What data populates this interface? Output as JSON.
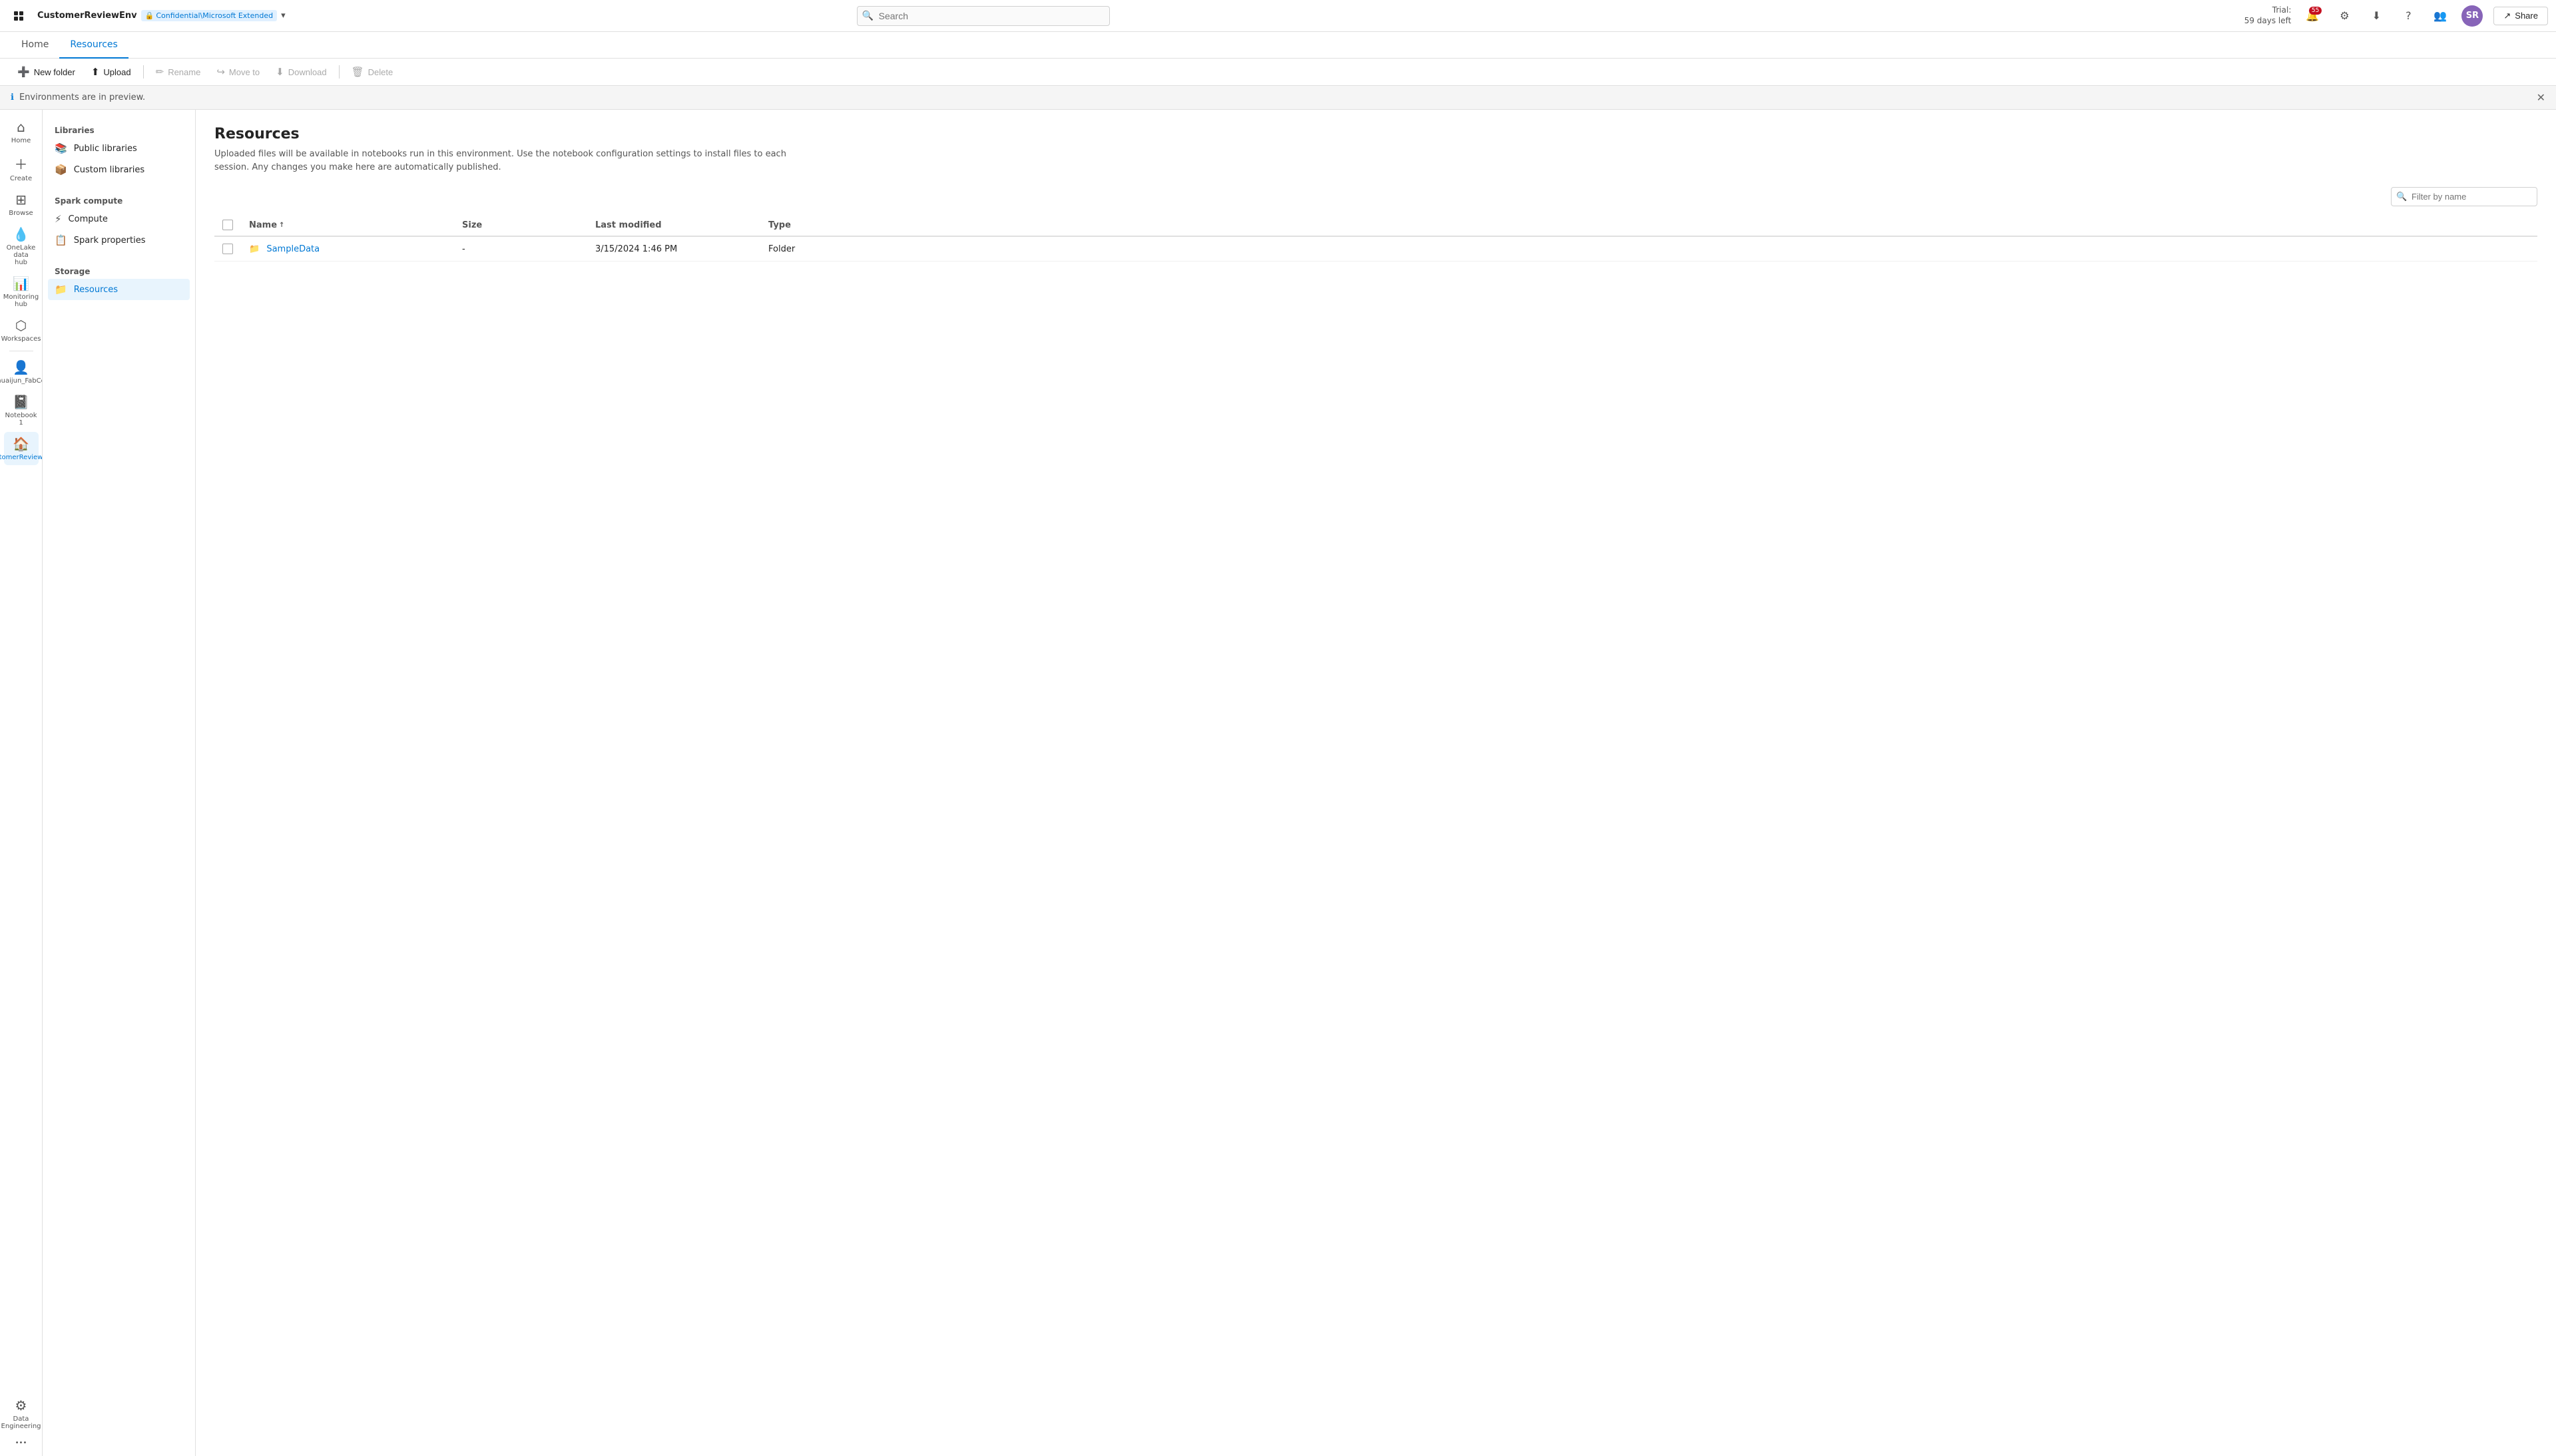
{
  "topbar": {
    "apps_label": "Apps",
    "env_name": "CustomerReviewEnv",
    "confidential_label": "Confidential\\Microsoft Extended",
    "dropdown_icon": "▾",
    "search_placeholder": "Search",
    "trial_line1": "Trial:",
    "trial_line2": "59 days left",
    "notif_count": "55",
    "share_label": "Share",
    "avatar_initials": "SR"
  },
  "nav": {
    "tabs": [
      {
        "id": "home",
        "label": "Home"
      },
      {
        "id": "resources",
        "label": "Resources"
      }
    ],
    "active_tab": "resources"
  },
  "toolbar": {
    "new_folder_label": "New folder",
    "upload_label": "Upload",
    "rename_label": "Rename",
    "move_to_label": "Move to",
    "download_label": "Download",
    "delete_label": "Delete"
  },
  "banner": {
    "message": "Environments are in preview."
  },
  "icon_nav": {
    "items": [
      {
        "id": "home",
        "icon": "⌂",
        "label": "Home"
      },
      {
        "id": "create",
        "icon": "+",
        "label": "Create"
      },
      {
        "id": "browse",
        "icon": "⊞",
        "label": "Browse"
      },
      {
        "id": "onelake",
        "icon": "💧",
        "label": "OneLake data hub"
      },
      {
        "id": "monitoring",
        "icon": "📊",
        "label": "Monitoring hub"
      },
      {
        "id": "workspaces",
        "icon": "⬡",
        "label": "Workspaces"
      },
      {
        "id": "shuaijun",
        "icon": "👤",
        "label": "Shuaijun_FabCon"
      },
      {
        "id": "notebook1",
        "icon": "📓",
        "label": "Notebook 1"
      },
      {
        "id": "customerenv",
        "icon": "🏠",
        "label": "CustomerReviewEnv",
        "active": true
      },
      {
        "id": "data-eng",
        "icon": "⚙",
        "label": "Data Engineering"
      }
    ],
    "more_label": "..."
  },
  "sidebar": {
    "libraries_section": "Libraries",
    "libraries_items": [
      {
        "id": "public-libraries",
        "label": "Public libraries",
        "icon": "📚"
      },
      {
        "id": "custom-libraries",
        "label": "Custom libraries",
        "icon": "📦"
      }
    ],
    "compute_section": "Spark compute",
    "compute_items": [
      {
        "id": "compute",
        "label": "Compute",
        "icon": "⚡"
      },
      {
        "id": "spark-properties",
        "label": "Spark properties",
        "icon": "📋"
      }
    ],
    "storage_section": "Storage",
    "storage_items": [
      {
        "id": "resources",
        "label": "Resources",
        "icon": "📁",
        "active": true
      }
    ]
  },
  "content": {
    "title": "Resources",
    "description": "Uploaded files will be available in notebooks run in this environment. Use the notebook configuration settings to install files to each session. Any changes you make here are automatically published.",
    "filter_placeholder": "Filter by name",
    "table": {
      "columns": [
        {
          "id": "name",
          "label": "Name",
          "sortable": true,
          "sort_icon": "↑"
        },
        {
          "id": "size",
          "label": "Size"
        },
        {
          "id": "last_modified",
          "label": "Last modified"
        },
        {
          "id": "type",
          "label": "Type"
        }
      ],
      "rows": [
        {
          "name": "SampleData",
          "size": "-",
          "last_modified": "3/15/2024 1:46 PM",
          "type": "Folder",
          "is_folder": true
        }
      ]
    }
  }
}
